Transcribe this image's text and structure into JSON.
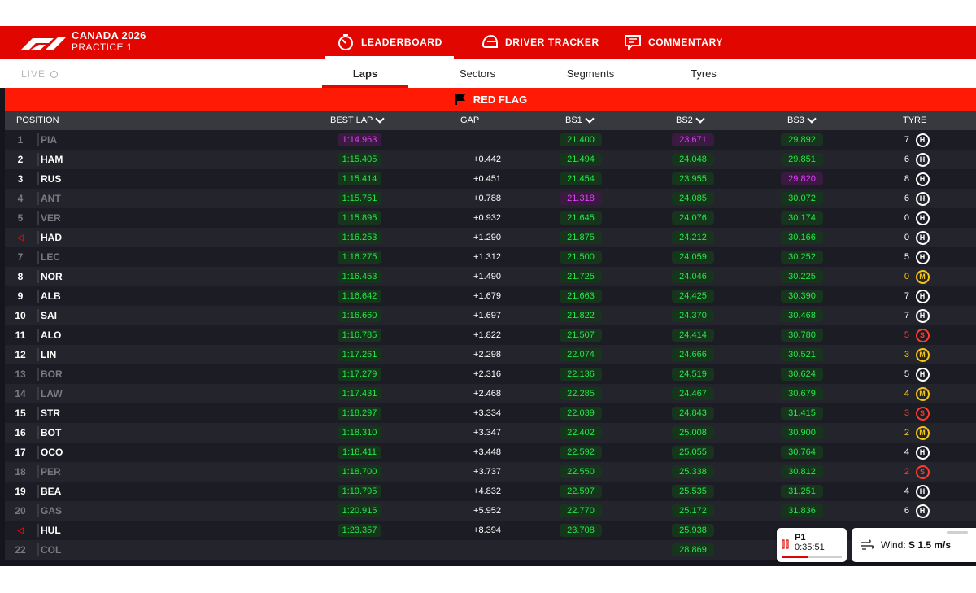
{
  "header": {
    "event_name": "CANADA 2026",
    "session_name": "PRACTICE 1",
    "tabs": [
      {
        "label": "LEADERBOARD",
        "active": true
      },
      {
        "label": "DRIVER TRACKER",
        "active": false
      },
      {
        "label": "COMMENTARY",
        "active": false
      }
    ]
  },
  "subnav": {
    "live_label": "LIVE",
    "tabs": [
      {
        "label": "Laps",
        "active": true
      },
      {
        "label": "Sectors",
        "active": false
      },
      {
        "label": "Segments",
        "active": false
      },
      {
        "label": "Tyres",
        "active": false
      }
    ]
  },
  "flag": {
    "label": "RED FLAG",
    "color": "#ff1a05"
  },
  "columns": {
    "position": "POSITION",
    "best_lap": "BEST LAP",
    "gap": "GAP",
    "bs1": "BS1",
    "bs2": "BS2",
    "bs3": "BS3",
    "tyre": "TYRE"
  },
  "colors": {
    "brand": "#e10600",
    "green_text": "#26e64c",
    "purple_text": "#e040fb",
    "hard": "#ffffff",
    "medium": "#f5c518",
    "soft": "#ff3b30"
  },
  "rows": [
    {
      "pos": "1",
      "code": "PIA",
      "dim": true,
      "best": "1:14.963",
      "best_purple": true,
      "gap": "",
      "bs1": "21.400",
      "bs2": "23.671",
      "bs2_purple": true,
      "bs3": "29.892",
      "laps": "7",
      "tyre": "H"
    },
    {
      "pos": "2",
      "code": "HAM",
      "best": "1:15.405",
      "gap": "+0.442",
      "bs1": "21.494",
      "bs2": "24.048",
      "bs3": "29.851",
      "laps": "6",
      "tyre": "H"
    },
    {
      "pos": "3",
      "code": "RUS",
      "best": "1:15.414",
      "gap": "+0.451",
      "bs1": "21.454",
      "bs2": "23.955",
      "bs3": "29.820",
      "bs3_purple": true,
      "laps": "8",
      "tyre": "H"
    },
    {
      "pos": "4",
      "code": "ANT",
      "dim": true,
      "best": "1:15.751",
      "gap": "+0.788",
      "bs1": "21.318",
      "bs1_purple": true,
      "bs2": "24.085",
      "bs3": "30.072",
      "laps": "6",
      "tyre": "H"
    },
    {
      "pos": "5",
      "code": "VER",
      "dim": true,
      "best": "1:15.895",
      "gap": "+0.932",
      "bs1": "21.645",
      "bs2": "24.076",
      "bs3": "30.174",
      "laps": "0",
      "tyre": "H"
    },
    {
      "pos": "◁",
      "pos_red": true,
      "code": "HAD",
      "best": "1:16.253",
      "gap": "+1.290",
      "bs1": "21.875",
      "bs2": "24.212",
      "bs3": "30.166",
      "laps": "0",
      "tyre": "H"
    },
    {
      "pos": "7",
      "code": "LEC",
      "dim": true,
      "best": "1:16.275",
      "gap": "+1.312",
      "bs1": "21.500",
      "bs2": "24.059",
      "bs3": "30.252",
      "laps": "5",
      "tyre": "H"
    },
    {
      "pos": "8",
      "code": "NOR",
      "best": "1:16.453",
      "gap": "+1.490",
      "bs1": "21.725",
      "bs2": "24.046",
      "bs3": "30.225",
      "laps": "0",
      "tyre": "M"
    },
    {
      "pos": "9",
      "code": "ALB",
      "best": "1:16.642",
      "gap": "+1.679",
      "bs1": "21.663",
      "bs2": "24.425",
      "bs3": "30.390",
      "laps": "7",
      "tyre": "H"
    },
    {
      "pos": "10",
      "code": "SAI",
      "best": "1:16.660",
      "gap": "+1.697",
      "bs1": "21.822",
      "bs2": "24.370",
      "bs3": "30.468",
      "laps": "7",
      "tyre": "H"
    },
    {
      "pos": "11",
      "code": "ALO",
      "best": "1:16.785",
      "gap": "+1.822",
      "bs1": "21.507",
      "bs2": "24.414",
      "bs3": "30.780",
      "laps": "5",
      "tyre": "S"
    },
    {
      "pos": "12",
      "code": "LIN",
      "best": "1:17.261",
      "gap": "+2.298",
      "bs1": "22.074",
      "bs2": "24.666",
      "bs3": "30.521",
      "laps": "3",
      "tyre": "M"
    },
    {
      "pos": "13",
      "code": "BOR",
      "dim": true,
      "best": "1:17.279",
      "gap": "+2.316",
      "bs1": "22.136",
      "bs2": "24.519",
      "bs3": "30.624",
      "laps": "5",
      "tyre": "H"
    },
    {
      "pos": "14",
      "code": "LAW",
      "dim": true,
      "best": "1:17.431",
      "gap": "+2.468",
      "bs1": "22.285",
      "bs2": "24.467",
      "bs3": "30.679",
      "laps": "4",
      "tyre": "M"
    },
    {
      "pos": "15",
      "code": "STR",
      "best": "1:18.297",
      "gap": "+3.334",
      "bs1": "22.039",
      "bs2": "24.843",
      "bs3": "31.415",
      "laps": "3",
      "tyre": "S"
    },
    {
      "pos": "16",
      "code": "BOT",
      "best": "1:18.310",
      "gap": "+3.347",
      "bs1": "22.402",
      "bs2": "25.008",
      "bs3": "30.900",
      "laps": "2",
      "tyre": "M"
    },
    {
      "pos": "17",
      "code": "OCO",
      "best": "1:18.411",
      "gap": "+3.448",
      "bs1": "22.592",
      "bs2": "25.055",
      "bs3": "30.764",
      "laps": "4",
      "tyre": "H"
    },
    {
      "pos": "18",
      "code": "PER",
      "dim": true,
      "best": "1:18.700",
      "gap": "+3.737",
      "bs1": "22.550",
      "bs2": "25.338",
      "bs3": "30.812",
      "laps": "2",
      "tyre": "S"
    },
    {
      "pos": "19",
      "code": "BEA",
      "best": "1:19.795",
      "gap": "+4.832",
      "bs1": "22.597",
      "bs2": "25.535",
      "bs3": "31.251",
      "laps": "4",
      "tyre": "H"
    },
    {
      "pos": "20",
      "code": "GAS",
      "dim": true,
      "best": "1:20.915",
      "gap": "+5.952",
      "bs1": "22.770",
      "bs2": "25.172",
      "bs3": "31.836",
      "laps": "6",
      "tyre": "H"
    },
    {
      "pos": "◁",
      "pos_red": true,
      "code": "HUL",
      "best": "1:23.357",
      "gap": "+8.394",
      "bs1": "23.708",
      "bs2": "25.938",
      "bs3": "",
      "laps": "",
      "tyre": ""
    },
    {
      "pos": "22",
      "code": "COL",
      "dim": true,
      "best": "",
      "gap": "",
      "bs1": "",
      "bs2": "28.869",
      "bs3": "",
      "laps": "",
      "tyre": ""
    }
  ],
  "session_widget": {
    "label": "P1",
    "time": "0:35:51",
    "progress": 0.45
  },
  "weather_widget": {
    "label": "Wind:",
    "value": "S 1.5 m/s"
  }
}
